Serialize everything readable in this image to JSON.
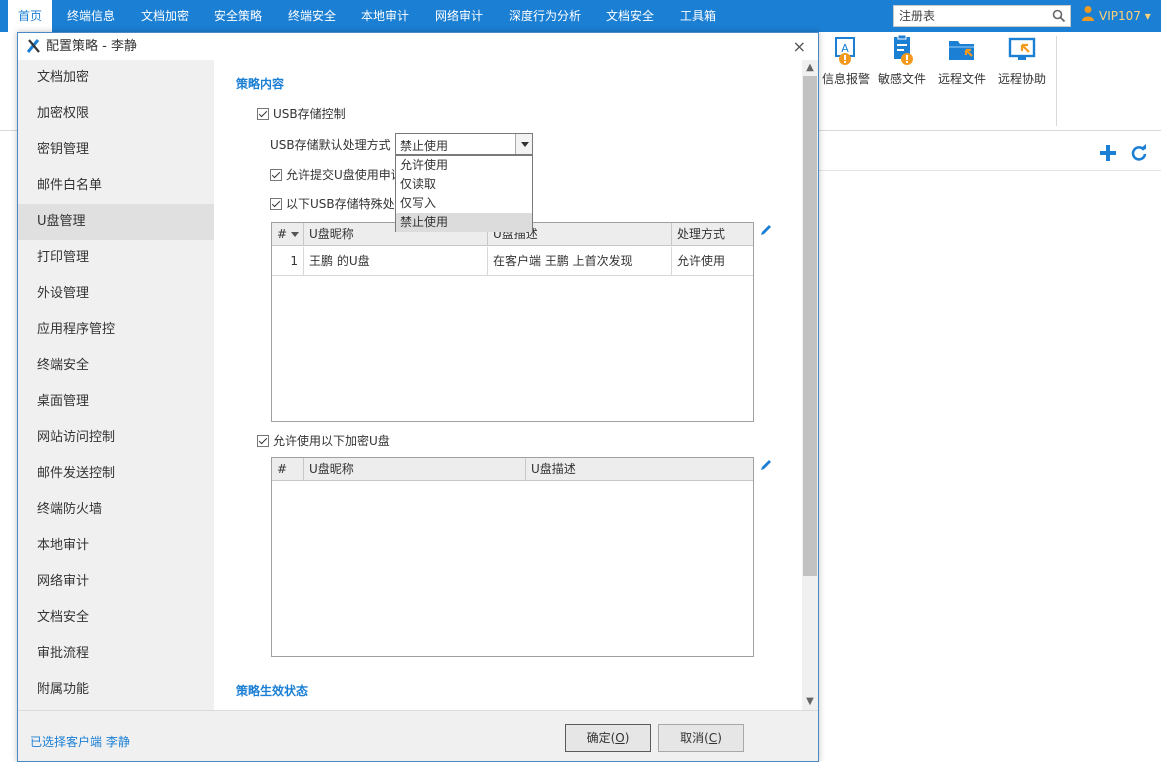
{
  "nav": {
    "items": [
      "首页",
      "终端信息",
      "文档加密",
      "安全策略",
      "终端安全",
      "本地审计",
      "网络审计",
      "深度行为分析",
      "文档安全",
      "工具箱"
    ],
    "search_placeholder": "注册表",
    "user": "VIP107",
    "user_caret": "▾"
  },
  "toolbar": {
    "buttons": [
      {
        "label": "信息报警",
        "icon": "alert-message-icon"
      },
      {
        "label": "敏感文件",
        "icon": "sensitive-file-icon"
      },
      {
        "label": "远程文件",
        "icon": "remote-file-icon"
      },
      {
        "label": "远程协助",
        "icon": "remote-assist-icon"
      }
    ]
  },
  "dialog": {
    "title": "配置策略 - 李静",
    "close": "×",
    "sidebar": [
      "文档加密",
      "加密权限",
      "密钥管理",
      "邮件白名单",
      "U盘管理",
      "打印管理",
      "外设管理",
      "应用程序管控",
      "终端安全",
      "桌面管理",
      "网站访问控制",
      "邮件发送控制",
      "终端防火墙",
      "本地审计",
      "网络审计",
      "文档安全",
      "审批流程",
      "附属功能"
    ],
    "sidebar_active": 4,
    "content": {
      "section_title": "策略内容",
      "usb_control_label": "USB存储控制",
      "default_action_label": "USB存储默认处理方式",
      "default_action_value": "禁止使用",
      "dropdown_options": [
        "允许使用",
        "仅读取",
        "仅写入",
        "禁止使用"
      ],
      "dropdown_selected": 3,
      "allow_request_label": "允许提交U盘使用申请",
      "special_label": "以下USB存储特殊处理",
      "table1": {
        "headers": [
          "#",
          "U盘昵称",
          "U盘描述",
          "处理方式"
        ],
        "rows": [
          {
            "index": "1",
            "name": "王鹏 的U盘",
            "desc": "在客户端 王鹏 上首次发现",
            "action": "允许使用"
          }
        ]
      },
      "encrypted_usb_label": "允许使用以下加密U盘",
      "table2": {
        "headers": [
          "#",
          "U盘昵称",
          "U盘描述"
        ]
      },
      "section2_title": "策略生效状态"
    },
    "footer": {
      "status": "已选择客户端 李静",
      "ok": "确定(",
      "ok_key": "O",
      "cancel": "取消(",
      "cancel_key": "C",
      "close_paren": ")"
    }
  },
  "colors": {
    "brand": "#1b7fd4",
    "user_accent": "#ffd27a",
    "warning": "#f39a1e"
  }
}
